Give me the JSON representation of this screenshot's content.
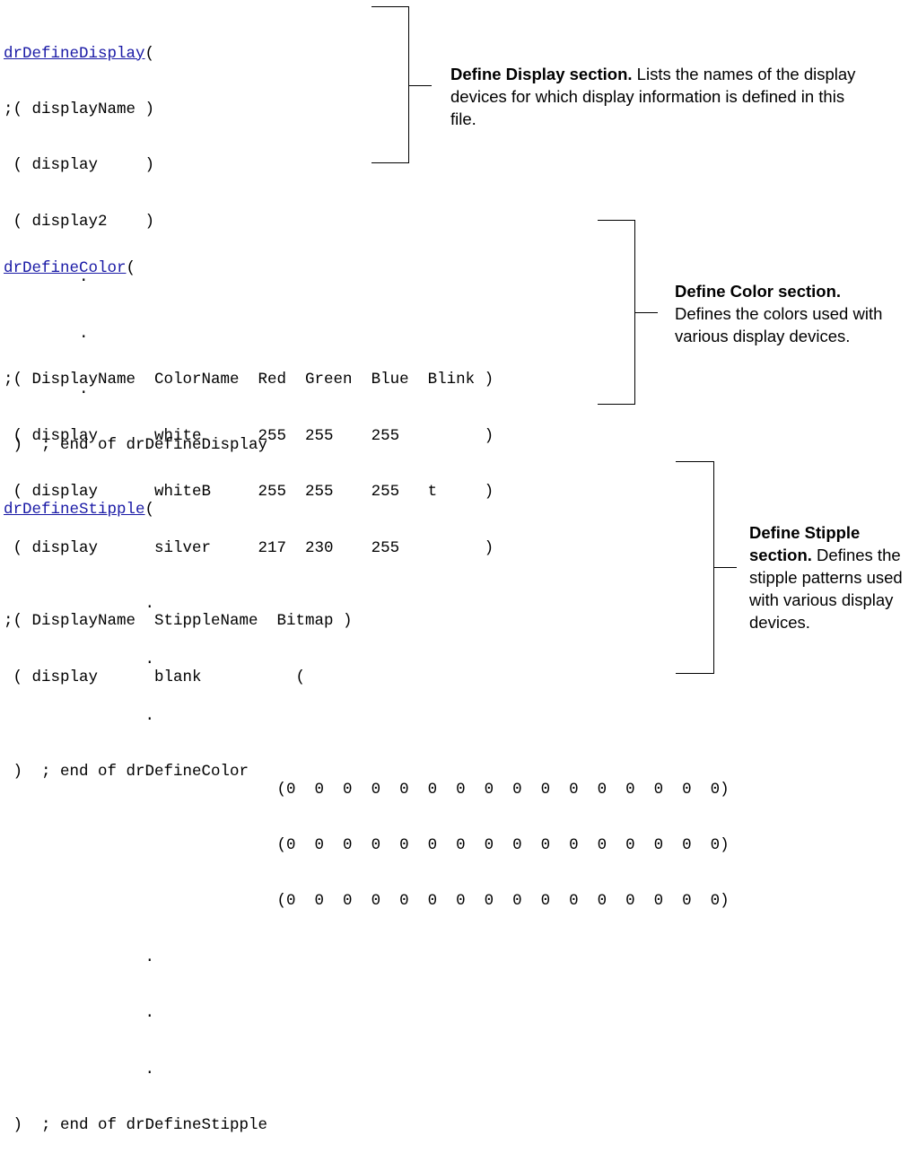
{
  "display": {
    "func": "drDefineDisplay",
    "paren": "(",
    "lines": [
      ";( displayName )",
      " ( display     )",
      " ( display2    )",
      "        .",
      "        .",
      "        .",
      " )  ; end of drDefineDisplay"
    ],
    "note_bold": "Define Display section.",
    "note_text": " Lists the names of the display devices for which display information is defined in this file."
  },
  "color": {
    "func": "drDefineColor",
    "paren": "(",
    "lines": [
      "",
      ";( DisplayName  ColorName  Red  Green  Blue  Blink )",
      " ( display      white      255  255    255         )",
      " ( display      whiteB     255  255    255   t     )",
      " ( display      silver     217  230    255         )",
      "               .",
      "               .",
      "               .",
      " )  ; end of drDefineColor"
    ],
    "note_bold": "Define Color section.",
    "note_text": " Defines the colors used with various display devices."
  },
  "stipple": {
    "func": "drDefineStipple",
    "paren": "(",
    "lines": [
      "",
      ";( DisplayName  StippleName  Bitmap )",
      " ( display      blank          (",
      "",
      "                             (0  0  0  0  0  0  0  0  0  0  0  0  0  0  0  0)",
      "                             (0  0  0  0  0  0  0  0  0  0  0  0  0  0  0  0)",
      "                             (0  0  0  0  0  0  0  0  0  0  0  0  0  0  0  0)",
      "               .",
      "               .",
      "               .",
      " )  ; end of drDefineStipple"
    ],
    "note_bold": "Define Stipple section.",
    "note_text": " Defines the stipple patterns used with various display devices."
  }
}
